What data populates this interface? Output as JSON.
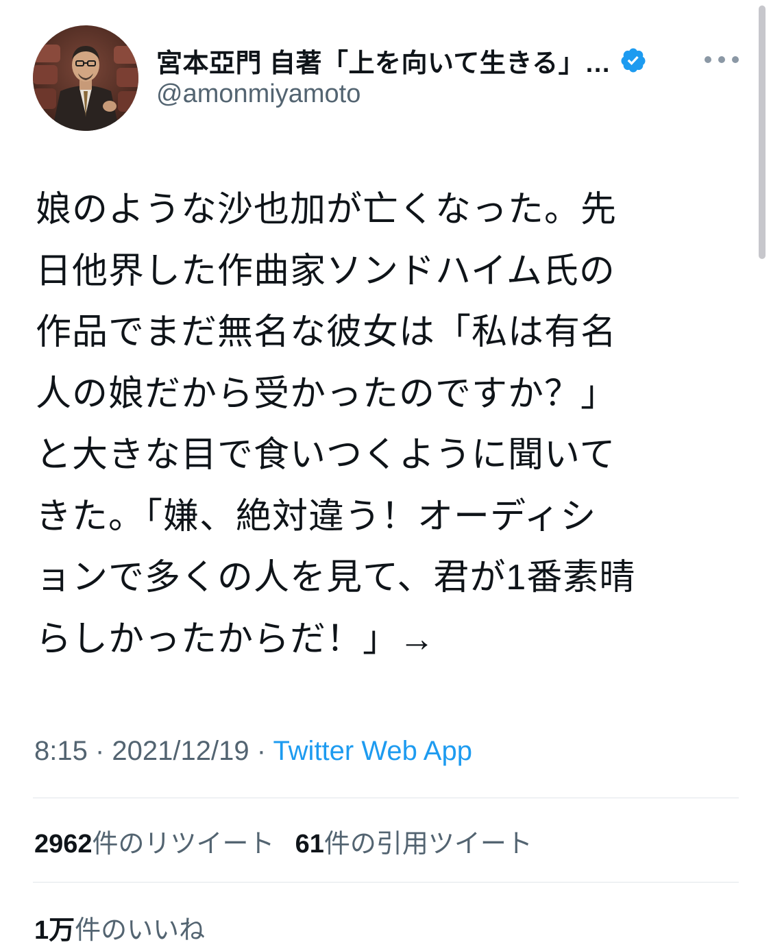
{
  "author": {
    "display_name": "宮本亞門 自著「上を向いて生きる」…",
    "handle": "@amonmiyamoto",
    "verified": true
  },
  "tweet": {
    "lines": [
      "娘のような沙也加が亡くなった。先",
      "日他界した作曲家ソンドハイム氏の",
      "作品でまだ無名な彼女は「私は有名",
      "人の娘だから受かったのですか？」",
      "と大きな目で食いつくように聞いて",
      "きた。「嫌、絶対違う！オーディシ",
      "ョンで多くの人を見て、君が1番素晴",
      "らしかったからだ！」→"
    ]
  },
  "meta": {
    "time": "8:15",
    "separator": " · ",
    "date": "2021/12/19",
    "source": "Twitter Web App"
  },
  "stats": {
    "retweets_count": "2962",
    "retweets_label": "件のリツイート",
    "quotes_count": "61",
    "quotes_label": "件の引用ツイート",
    "likes_count": "1万",
    "likes_label": "件のいいね"
  },
  "icons": {
    "verified": "verified-badge-icon",
    "more": "more-options-icon"
  },
  "colors": {
    "accent": "#1d9bf0",
    "text_primary": "#0f1419",
    "text_secondary": "#536471",
    "divider": "#e1e6ea"
  }
}
